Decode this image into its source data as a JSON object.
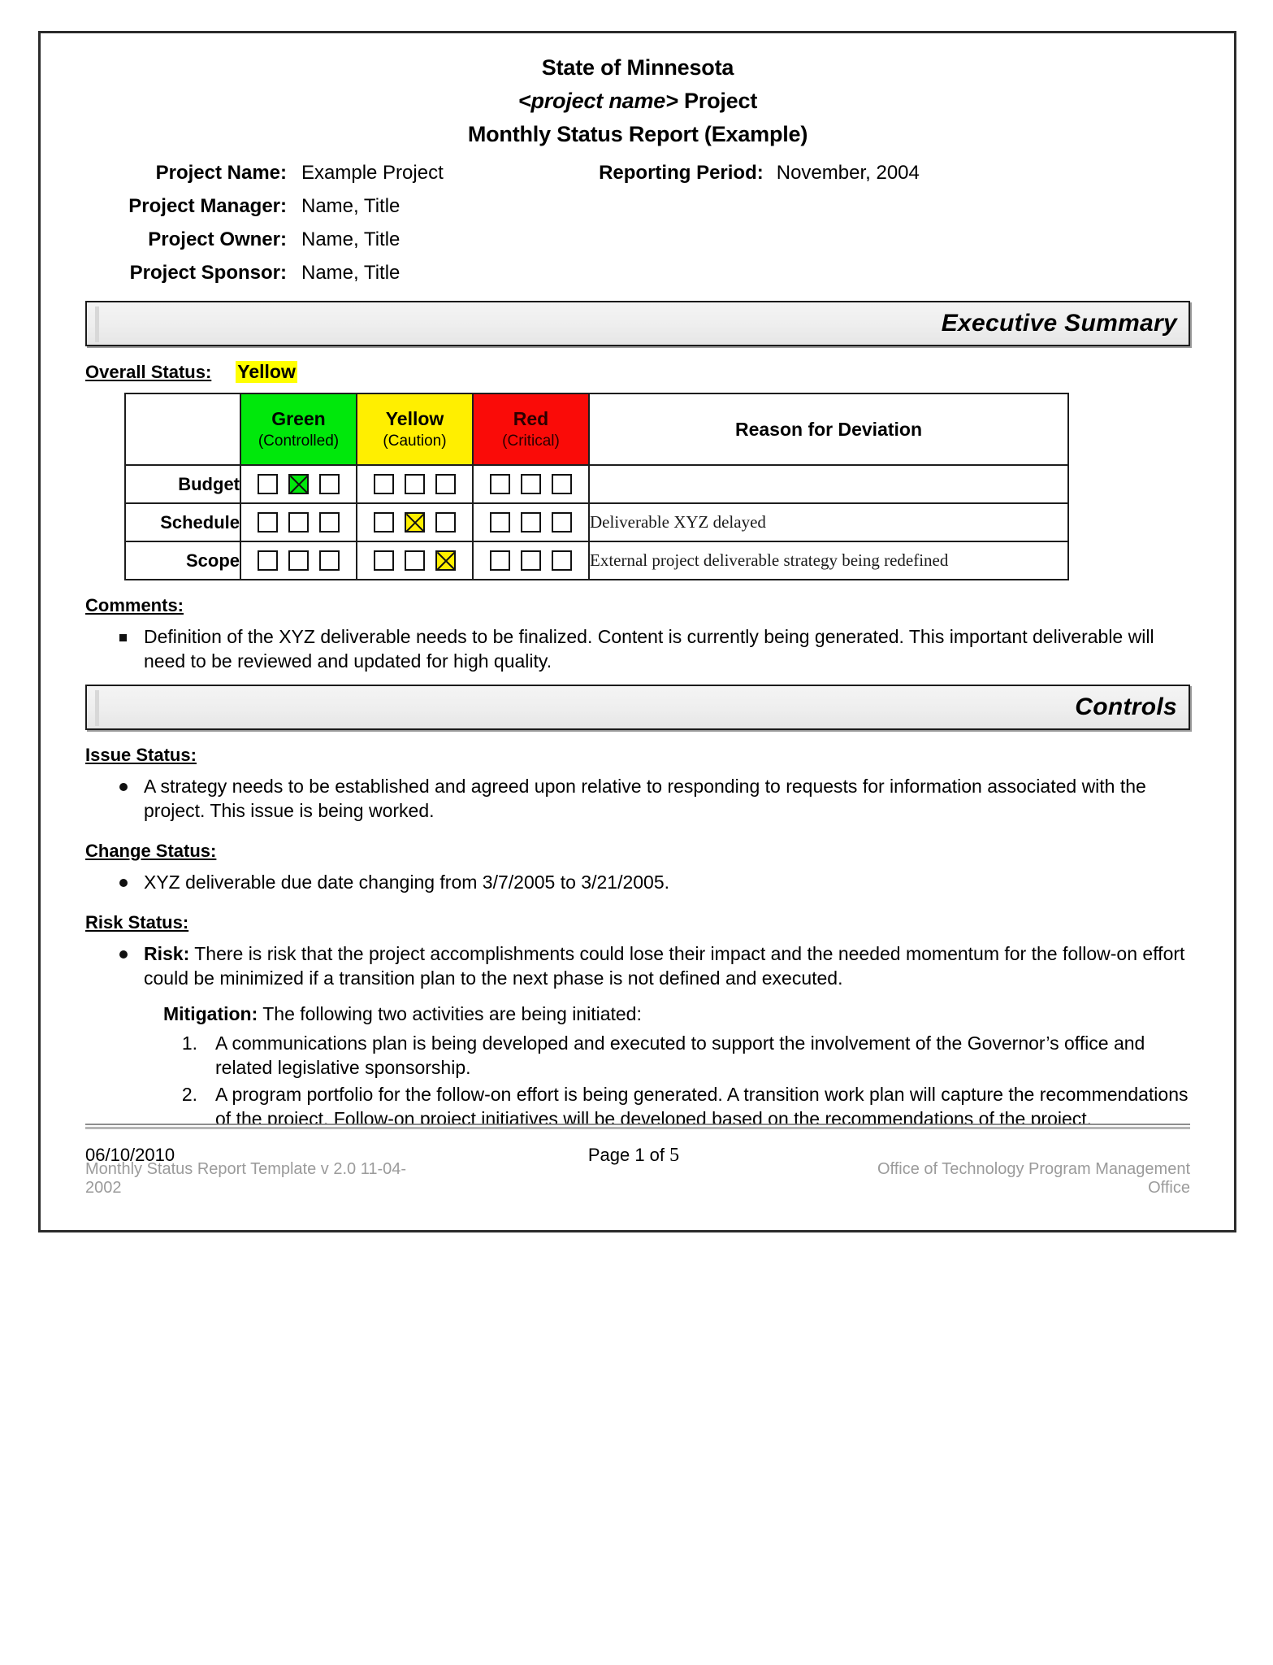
{
  "header": {
    "line1": "State of Minnesota",
    "line2_italic": "<project name>",
    "line2_rest": " Project",
    "line3": "Monthly Status Report (Example)"
  },
  "meta": {
    "project_name_label": "Project Name:",
    "project_name_value": "Example Project",
    "reporting_period_label": "Reporting Period:",
    "reporting_period_value": "November, 2004",
    "project_manager_label": "Project Manager:",
    "project_manager_value": "Name, Title",
    "project_owner_label": "Project Owner:",
    "project_owner_value": "Name, Title",
    "project_sponsor_label": "Project Sponsor:",
    "project_sponsor_value": "Name, Title"
  },
  "executive_summary": {
    "banner_title": "Executive Summary",
    "overall_status_label": "Overall Status:",
    "overall_status_value": "Yellow",
    "table": {
      "columns": [
        {
          "name": "Green",
          "sub": "(Controlled)",
          "color": "#00e80b"
        },
        {
          "name": "Yellow",
          "sub": "(Caution)",
          "color": "#ffef00"
        },
        {
          "name": "Red",
          "sub": "(Critical)",
          "color": "#fa0b08"
        }
      ],
      "reason_header": "Reason for Deviation",
      "rows": [
        {
          "label": "Budget",
          "green": [
            false,
            true,
            false
          ],
          "yellow": [
            false,
            false,
            false
          ],
          "red": [
            false,
            false,
            false
          ],
          "reason": ""
        },
        {
          "label": "Schedule",
          "green": [
            false,
            false,
            false
          ],
          "yellow": [
            false,
            true,
            false
          ],
          "red": [
            false,
            false,
            false
          ],
          "reason": "Deliverable XYZ delayed"
        },
        {
          "label": "Scope",
          "green": [
            false,
            false,
            false
          ],
          "yellow": [
            false,
            false,
            true
          ],
          "red": [
            false,
            false,
            false
          ],
          "reason": "External project deliverable strategy being redefined"
        }
      ]
    },
    "comments_label": "Comments:",
    "comments": [
      "Definition of the XYZ deliverable needs to be finalized.  Content is currently being generated.  This important deliverable will need to be reviewed and updated for high quality."
    ]
  },
  "controls": {
    "banner_title": "Controls",
    "issue_status_label": "Issue Status:",
    "issue_items": [
      "A strategy needs to be established and agreed upon relative to responding to requests for information associated with the project.  This issue is being worked."
    ],
    "change_status_label": "Change Status:",
    "change_items": [
      "XYZ deliverable due date changing from 3/7/2005 to 3/21/2005."
    ],
    "risk_status_label": "Risk Status:",
    "risk_bold_lead": "Risk:",
    "risk_text": " There is risk that the project accomplishments could lose their impact and the needed momentum for the follow-on effort could be minimized if a transition plan to the next phase is not defined and executed.",
    "mitigation_bold_lead": "Mitigation:",
    "mitigation_text": "  The following two activities are being initiated:",
    "mitigation_items": [
      {
        "num": "1.",
        "text": "A communications plan is being developed and executed to support the involvement of the Governor’s office and related legislative sponsorship."
      },
      {
        "num": "2.",
        "text": "A program portfolio for the follow-on effort is being generated. A transition work plan will capture the recommendations of the project. Follow-on project initiatives will be developed based on the recommendations of the project."
      }
    ]
  },
  "footer": {
    "date": "06/10/2010",
    "page_prefix": "Page 1 of ",
    "page_total": "5",
    "template_note": "Monthly Status Report Template  v 2.0  11-04-2002",
    "office": "Office of Technology Program Management Office"
  }
}
